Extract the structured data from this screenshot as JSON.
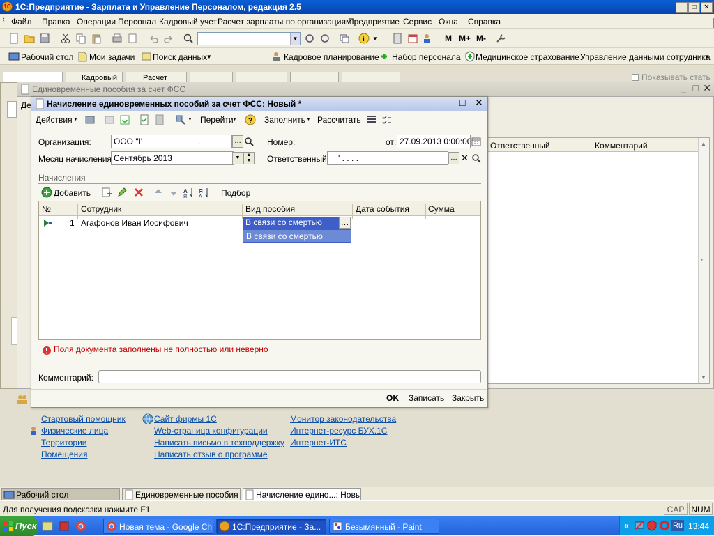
{
  "app": {
    "title": "1С:Предприятие - Зарплата и Управление Персоналом, редакция 2.5",
    "window_btns": [
      "_",
      "□",
      "✕"
    ]
  },
  "menu": [
    {
      "label": "Файл"
    },
    {
      "label": "Правка"
    },
    {
      "label": "Операции"
    },
    {
      "label": "Персонал"
    },
    {
      "label": "Кадровый учет"
    },
    {
      "label": "Расчет зарплаты по организациям"
    },
    {
      "label": "Предприятие"
    },
    {
      "label": "Сервис"
    },
    {
      "label": "Окна"
    },
    {
      "label": "Справка"
    }
  ],
  "toolbar2": {
    "desktop": "Рабочий стол",
    "tasks": "Мои задачи",
    "search": "Поиск данных",
    "planning": "Кадровое планирование",
    "recruit": "Набор персонала",
    "medical": "Медицинское страхование",
    "employee_data": "Управление данными сотрудника"
  },
  "tabs_strip": {
    "tab1": "Кадровый",
    "tab2": "Расчет",
    "show_tabs": "Показывать стать"
  },
  "bg_window": {
    "title": "Единовременные пособия за счет ФСС",
    "col_responsible": "Ответственный",
    "col_comment": "Комментарий",
    "left_tab": "Де"
  },
  "dialog": {
    "title": "Начисление единовременных пособий за счет ФСС: Новый *",
    "toolbar": {
      "actions": "Действия",
      "goto": "Перейти",
      "fill": "Заполнить",
      "calculate": "Рассчитать"
    },
    "labels": {
      "org": "Организация:",
      "month": "Месяц начисления:",
      "number": "Номер:",
      "from": "от:",
      "responsible": "Ответственный:"
    },
    "values": {
      "org": "ООО \"I'",
      "org_dot": ".",
      "month": "Сентябрь 2013",
      "date": "27.09.2013 0:00:00",
      "responsible": "' . . . ."
    },
    "section": "Начисления",
    "grid_toolbar": {
      "add": "Добавить",
      "selection": "Подбор"
    },
    "grid": {
      "headers": [
        "№",
        "Сотрудник",
        "Вид пособия",
        "Дата события",
        "Сумма"
      ],
      "rows": [
        {
          "n": "1",
          "employee": "Агафонов Иван Иосифович",
          "type": "В связи со смертью",
          "date": "",
          "sum": ""
        }
      ],
      "dropdown_option": "В связи со смертью"
    },
    "error": "Поля документа заполнены не полностью или неверно",
    "comment_label": "Комментарий:",
    "comment_value": "",
    "buttons": {
      "ok": "OK",
      "save": "Записать",
      "close": "Закрыть"
    }
  },
  "links": {
    "col1": [
      "Стартовый помощник",
      "Физические лица",
      "Территории",
      "Помещения"
    ],
    "col2": [
      "Сайт фирмы 1С",
      "Web-страница конфигурации",
      "Написать письмо в техподдержку",
      "Написать отзыв о программе"
    ],
    "col3": [
      "Монитор законодательства",
      "Интернет-ресурс БУХ.1С",
      "Интернет-ИТС"
    ]
  },
  "window_tabs": [
    "Рабочий стол",
    "Единовременные пособия ...",
    "Начисление едино...: Новый *"
  ],
  "status": {
    "hint": "Для получения подсказки нажмите F1",
    "cap": "CAP",
    "num": "NUM"
  },
  "taskbar": {
    "start": "Пуск",
    "items": [
      "Новая тема - Google Ch...",
      "1С:Предприятие - За...",
      "Безымянный - Paint"
    ],
    "lang": "Ru",
    "clock": "13:44"
  },
  "colors": {
    "selection": "#3f5fc8",
    "link": "#0b4fa8",
    "error": "#c00000",
    "titlebar": "#0a5fd6"
  }
}
